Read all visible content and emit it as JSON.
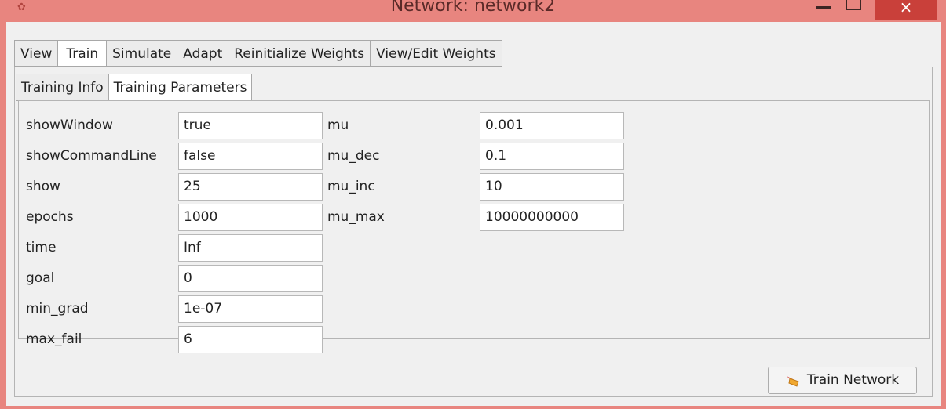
{
  "window": {
    "title": "Network: network2"
  },
  "tabs": [
    "View",
    "Train",
    "Simulate",
    "Adapt",
    "Reinitialize Weights",
    "View/Edit Weights"
  ],
  "active_tab": "Train",
  "subtabs": [
    "Training Info",
    "Training Parameters"
  ],
  "active_subtab": "Training Parameters",
  "params_left": [
    {
      "label": "showWindow",
      "value": "true"
    },
    {
      "label": "showCommandLine",
      "value": "false"
    },
    {
      "label": "show",
      "value": "25"
    },
    {
      "label": "epochs",
      "value": "1000"
    },
    {
      "label": "time",
      "value": "Inf"
    },
    {
      "label": "goal",
      "value": "0"
    },
    {
      "label": "min_grad",
      "value": "1e-07"
    },
    {
      "label": "max_fail",
      "value": "6"
    }
  ],
  "params_right": [
    {
      "label": "mu",
      "value": "0.001"
    },
    {
      "label": "mu_dec",
      "value": "0.1"
    },
    {
      "label": "mu_inc",
      "value": "10"
    },
    {
      "label": "mu_max",
      "value": "10000000000"
    }
  ],
  "train_button": {
    "label": "Train Network",
    "icon": "train-network-icon"
  },
  "colors": {
    "titlebar": "#e8857f",
    "close_button": "#c9403a",
    "client_bg": "#f0f0f0"
  }
}
